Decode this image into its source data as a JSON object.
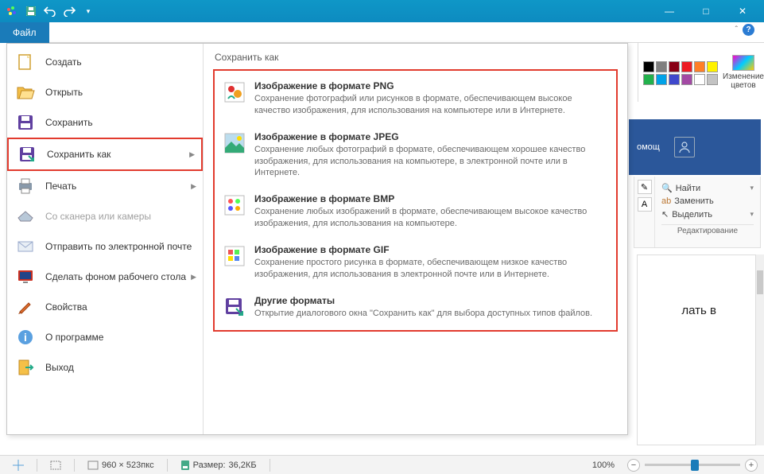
{
  "titlebar": {
    "minimize": "—",
    "maximize": "□",
    "close": "✕"
  },
  "menu": {
    "file_label": "Файл"
  },
  "backstage": {
    "items": [
      {
        "label": "Создать",
        "icon": "new"
      },
      {
        "label": "Открыть",
        "icon": "open"
      },
      {
        "label": "Сохранить",
        "icon": "save"
      },
      {
        "label": "Сохранить как",
        "icon": "saveas",
        "arrow": true,
        "highlighted": true
      },
      {
        "label": "Печать",
        "icon": "print",
        "arrow": true
      },
      {
        "label": "Со сканера или камеры",
        "icon": "scanner",
        "disabled": true
      },
      {
        "label": "Отправить по электронной почте",
        "icon": "mail"
      },
      {
        "label": "Сделать фоном рабочего стола",
        "icon": "desktop",
        "arrow": true
      },
      {
        "label": "Свойства",
        "icon": "props"
      },
      {
        "label": "О программе",
        "icon": "about"
      },
      {
        "label": "Выход",
        "icon": "exit"
      }
    ],
    "right_title": "Сохранить как",
    "save_options": [
      {
        "title": "Изображение в формате PNG",
        "desc": "Сохранение фотографий или рисунков в формате, обеспечивающем высокое качество изображения, для использования на компьютере или в Интернете.",
        "icon": "png"
      },
      {
        "title": "Изображение в формате JPEG",
        "desc": "Сохранение любых фотографий в формате, обеспечивающем хорошее качество изображения, для использования на компьютере, в электронной почте или в Интернете.",
        "icon": "jpeg"
      },
      {
        "title": "Изображение в формате BMP",
        "desc": "Сохранение любых изображений в формате, обеспечивающем высокое качество изображения, для использования на компьютере.",
        "icon": "bmp"
      },
      {
        "title": "Изображение в формате GIF",
        "desc": "Сохранение простого рисунка в формате, обеспечивающем низкое качество изображения, для использования в электронной почте или в Интернете.",
        "icon": "gif"
      },
      {
        "title": "Другие форматы",
        "desc": "Открытие диалогового окна \"Сохранить как\" для выбора доступных типов файлов.",
        "icon": "other"
      }
    ]
  },
  "ribbon_right": {
    "edit_colors": "Изменение\nцветов",
    "colors": {
      "row1": [
        "#000000",
        "#7f7f7f",
        "#880015",
        "#ed1c24",
        "#ff7f27",
        "#fff200"
      ],
      "row2": [
        "#22b14c",
        "#00a2e8",
        "#3f48cc",
        "#a349a4",
        "#ffffff",
        "#c3c3c3"
      ]
    }
  },
  "word": {
    "tab_label": "омощ",
    "find": "Найти",
    "replace": "Заменить",
    "select": "Выделить",
    "group": "Редактирование",
    "partial_text": "лать в"
  },
  "status": {
    "canvas_size": "960 × 523пкс",
    "file_size_label": "Размер:",
    "file_size": "36,2КБ",
    "zoom": "100%"
  }
}
